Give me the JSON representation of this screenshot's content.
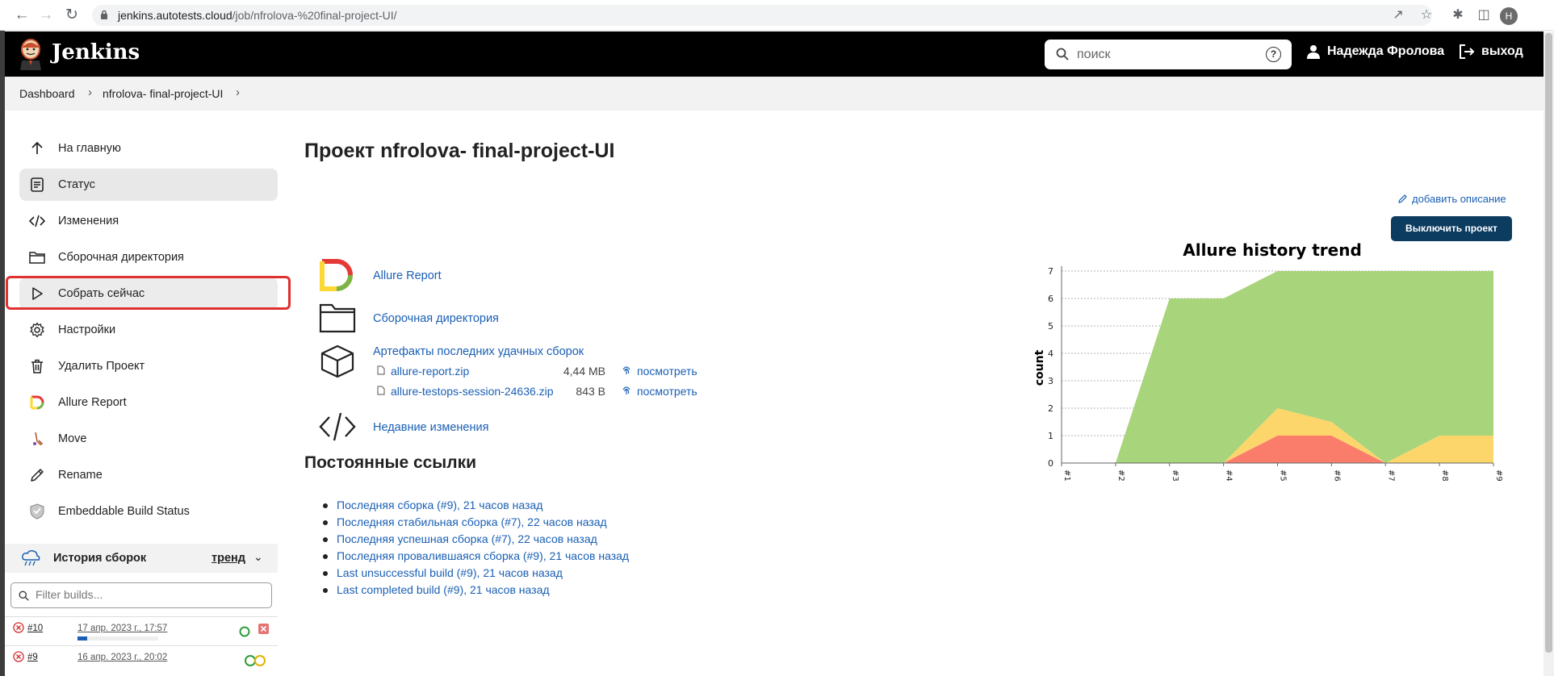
{
  "browser": {
    "url_host": "jenkins.autotests.cloud",
    "url_path": "/job/nfrolova-%20final-project-UI/",
    "profile_initial": "H"
  },
  "header": {
    "brand": "Jenkins",
    "search_placeholder": "поиск",
    "help": "?",
    "user_name": "Надежда Фролова",
    "logout": "выход"
  },
  "breadcrumb": [
    "Dashboard",
    "nfrolova- final-project-UI"
  ],
  "sidebar": {
    "items": [
      {
        "label": "На главную",
        "icon": "arrow-up-icon"
      },
      {
        "label": "Статус",
        "icon": "document-icon"
      },
      {
        "label": "Изменения",
        "icon": "code-icon"
      },
      {
        "label": "Сборочная директория",
        "icon": "folder-icon"
      },
      {
        "label": "Собрать сейчас",
        "icon": "play-icon"
      },
      {
        "label": "Настройки",
        "icon": "gear-icon"
      },
      {
        "label": "Удалить Проект",
        "icon": "trash-icon"
      },
      {
        "label": "Allure Report",
        "icon": "allure-icon"
      },
      {
        "label": "Move",
        "icon": "move-icon"
      },
      {
        "label": "Rename",
        "icon": "pencil-icon"
      },
      {
        "label": "Embeddable Build Status",
        "icon": "badge-icon"
      }
    ],
    "active_index": 1,
    "highlighted_index": 4
  },
  "build_history": {
    "title": "История сборок",
    "trend": "тренд",
    "filter_placeholder": "Filter builds...",
    "builds": [
      {
        "number": "#10",
        "date": "17 апр. 2023 г., 17:57",
        "status": "failed",
        "progress": 0.12
      },
      {
        "number": "#9",
        "date": "16 апр. 2023 г., 20:02",
        "status": "failed"
      }
    ]
  },
  "main": {
    "title": "Проект nfrolova- final-project-UI",
    "add_description": "добавить описание",
    "disable_button": "Выключить проект",
    "links": {
      "allure": "Allure Report",
      "workspace": "Сборочная директория",
      "artifacts": "Артефакты последних удачных сборок",
      "changes": "Недавние изменения"
    },
    "artifacts": [
      {
        "name": "allure-report.zip",
        "size": "4,44 MB",
        "view": "посмотреть"
      },
      {
        "name": "allure-testops-session-24636.zip",
        "size": "843 B",
        "view": "посмотреть"
      }
    ],
    "permalinks_title": "Постоянные ссылки",
    "permalinks": [
      "Последняя сборка (#9), 21 часов назад",
      "Последняя стабильная сборка (#7), 22 часов назад",
      "Последняя успешная сборка (#7), 22 часов назад",
      "Последняя провалившаяся сборка (#9), 21 часов назад",
      "Last unsuccessful build (#9), 21 часов назад",
      "Last completed build (#9), 21 часов назад"
    ]
  },
  "chart_data": {
    "type": "area",
    "title": "Allure history trend",
    "ylabel": "count",
    "xlabel": "",
    "categories": [
      "#1",
      "#2",
      "#3",
      "#4",
      "#5",
      "#6",
      "#7",
      "#8",
      "#9"
    ],
    "ylim": [
      0,
      7
    ],
    "yticks": [
      0,
      1,
      2,
      3,
      4,
      5,
      6,
      7
    ],
    "grid": true,
    "stacked": true,
    "series": [
      {
        "color": "#fa7c6b",
        "values": [
          0,
          0,
          0,
          0,
          1,
          1,
          0,
          0,
          0
        ]
      },
      {
        "color": "#fdd66b",
        "values": [
          0,
          0,
          0,
          0,
          1,
          0.5,
          0,
          1,
          1
        ]
      },
      {
        "color": "#a8d47b",
        "values": [
          0,
          0,
          6,
          6,
          5,
          5.5,
          7,
          6,
          6
        ]
      }
    ]
  },
  "colors": {
    "header_bg": "#000000",
    "link": "#1a5fb4",
    "disable_button_bg": "#0d3c61",
    "highlight": "#e03030"
  }
}
